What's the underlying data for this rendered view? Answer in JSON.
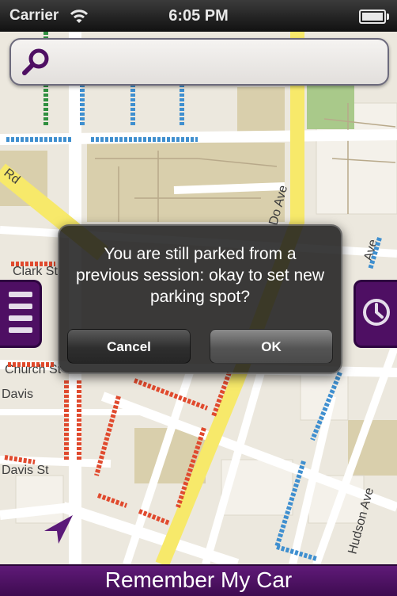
{
  "status_bar": {
    "carrier": "Carrier",
    "time": "6:05 PM",
    "wifi_icon": "wifi-icon",
    "battery_icon": "battery-icon"
  },
  "search": {
    "icon": "search-icon",
    "placeholder": ""
  },
  "map": {
    "street_labels": [
      "Rd",
      "Ave",
      "Clark St",
      "Church St",
      "Davis",
      "Davis St",
      "Hudson Ave",
      "Do Ave"
    ],
    "colors": {
      "road_major": "#f7e96a",
      "block": "#d9cfac",
      "park": "#a9c98a",
      "parking_available": "#3f8fcf",
      "parking_unavailable": "#e04a2e",
      "parking_green": "#2f8f3f"
    }
  },
  "side_buttons": {
    "menu_icon": "menu-icon",
    "history_icon": "clock-icon",
    "accent": "#4e0f63"
  },
  "dialog": {
    "message": "You are still parked from a previous session: okay to set new parking spot?",
    "cancel_label": "Cancel",
    "ok_label": "OK"
  },
  "location_icon": "location-arrow-icon",
  "bottom_bar": {
    "label": "Remember My Car"
  }
}
